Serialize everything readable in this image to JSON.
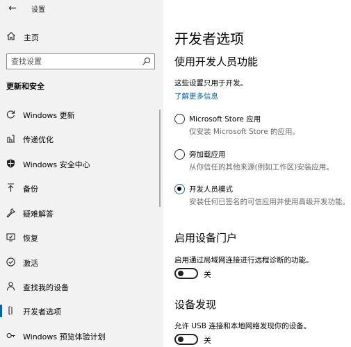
{
  "window": {
    "back_icon": "back-arrow-icon",
    "title": "设置"
  },
  "sidebar": {
    "home_label": "主页",
    "search_placeholder": "查找设置",
    "section_heading": "更新和安全",
    "items": [
      {
        "label": "Windows 更新",
        "icon": "refresh-icon"
      },
      {
        "label": "传递优化",
        "icon": "delivery-optimization-icon"
      },
      {
        "label": "Windows 安全中心",
        "icon": "shield-icon"
      },
      {
        "label": "备份",
        "icon": "backup-arrow-icon"
      },
      {
        "label": "疑难解答",
        "icon": "wrench-icon"
      },
      {
        "label": "恢复",
        "icon": "recovery-icon"
      },
      {
        "label": "激活",
        "icon": "check-circle-icon"
      },
      {
        "label": "查找我的设备",
        "icon": "person-locate-icon"
      },
      {
        "label": "开发者选项",
        "icon": "developer-icon",
        "selected": true
      },
      {
        "label": "Windows 预览体验计划",
        "icon": "insider-icon"
      }
    ]
  },
  "main": {
    "title": "开发者选项",
    "subtitle": "使用开发人员功能",
    "description": "这些设置只用于开发。",
    "learn_more": "了解更多信息",
    "options": [
      {
        "label": "Microsoft Store 应用",
        "desc": "仅安装 Microsoft Store 的应用。",
        "checked": false
      },
      {
        "label": "旁加载应用",
        "desc": "从你信任的其他来源(例如工作区)安装应用。",
        "checked": false
      },
      {
        "label": "开发人员模式",
        "desc": "安装任何已签名的可信应用并使用高级开发功能。",
        "checked": true
      }
    ],
    "portal": {
      "title": "启用设备门户",
      "desc": "启用通过局域网连接进行远程诊断的功能。",
      "toggle_label": "关"
    },
    "discovery": {
      "title": "设备发现",
      "desc": "允许 USB 连接和本地网络发现你的设备。",
      "toggle_label": "关"
    }
  }
}
